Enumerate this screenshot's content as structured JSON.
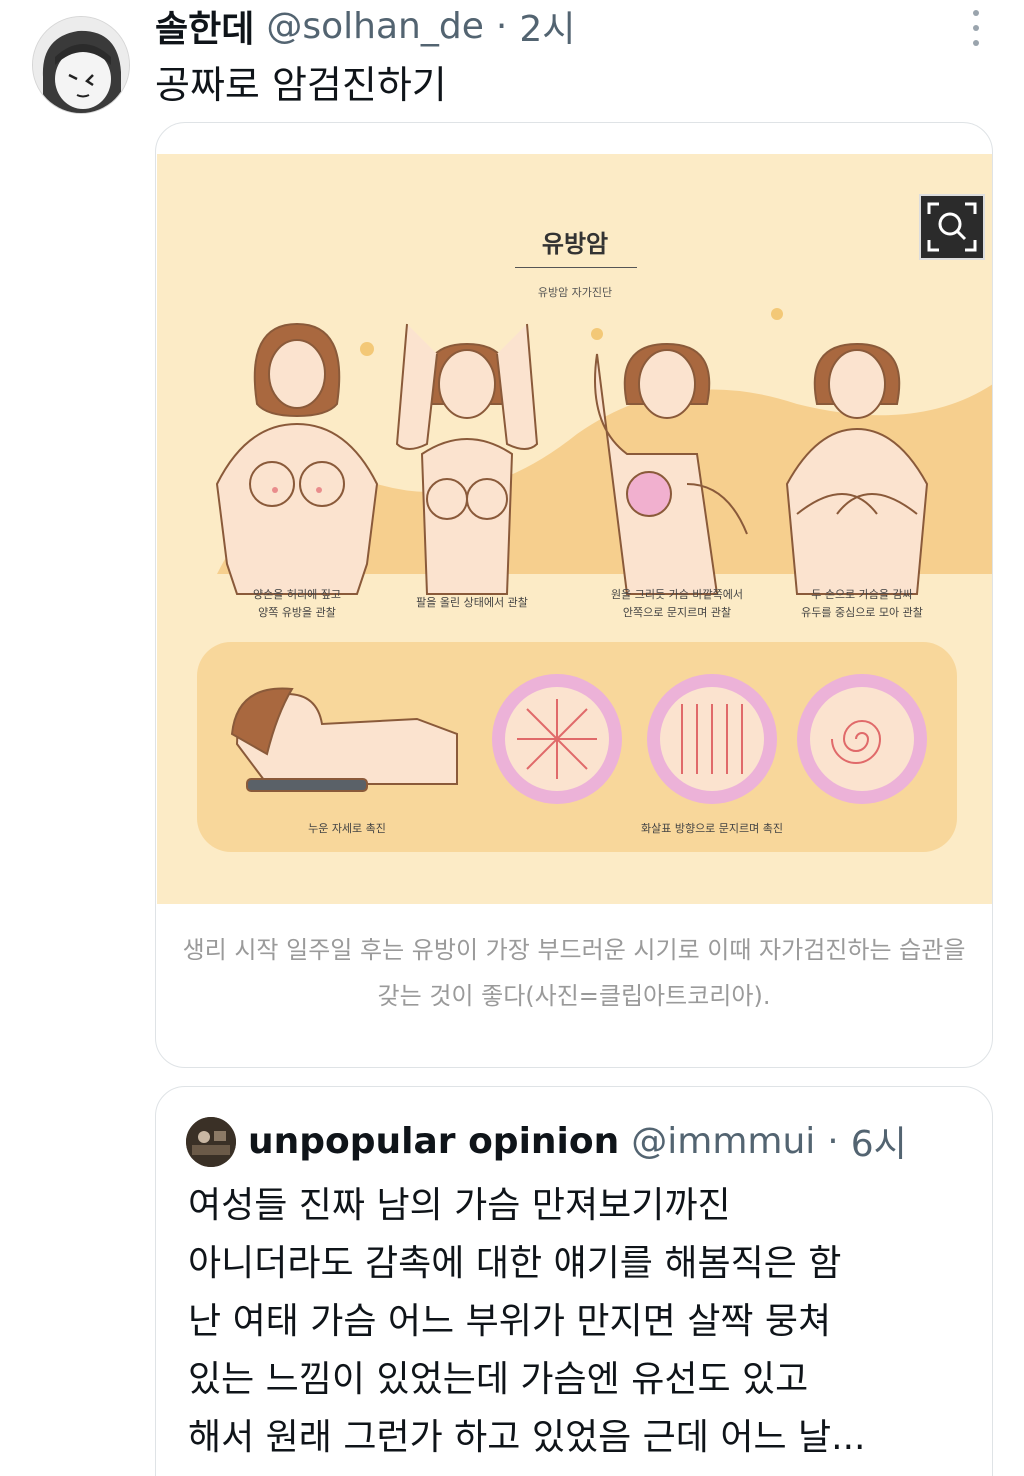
{
  "tweet": {
    "display_name": "솔한데",
    "handle": "@solhan_de",
    "separator": "·",
    "time": "2시",
    "text": "공짜로 암검진하기"
  },
  "card": {
    "image": {
      "title": "유방암",
      "subtitle": "유방암 자가진단",
      "steps": [
        {
          "line1": "양손을 허리에 짚고",
          "line2": "양쪽 유방을 관찰"
        },
        {
          "line1": "팔을 올린 상태에서 관찰",
          "line2": ""
        },
        {
          "line1": "원을 그리듯 가슴 바깥쪽에서",
          "line2": "안쪽으로 문지르며 관찰"
        },
        {
          "line1": "두 손으로 가슴을 감싸",
          "line2": "유두를 중심으로 모아 관찰"
        }
      ],
      "bottom_left_label": "누운 자세로 촉진",
      "bottom_right_label": "화살표 방향으로 문지르며 촉진"
    },
    "caption": "생리 시작 일주일 후는 유방이 가장 부드러운 시기로 이때 자가검진하는 습관을 갖는 것이 좋다(사진=클립아트코리아)."
  },
  "quote": {
    "display_name": "unpopular opinion",
    "handle": "@immmui",
    "separator": "·",
    "time": "6시",
    "lines": [
      "여성들 진짜 남의 가슴 만져보기까진",
      "아니더라도 감촉에 대한 얘기를 해봄직은 함",
      "난 여태 가슴 어느 부위가 만지면 살짝 뭉쳐",
      "있는 느낌이 있었는데 가슴엔 유선도 있고",
      "해서 원래 그런가 하고 있었음 근데 어느 날..."
    ]
  },
  "icons": {
    "more": "more-vertical-icon",
    "zoom": "zoom-magnifier-icon"
  },
  "colors": {
    "image_bg": "#fcebc6",
    "panel": "#f8d79b",
    "skin": "#fbe3cf",
    "hair": "#a9683f",
    "pink_ring": "#ecb2d8",
    "muted_text": "#536471"
  }
}
